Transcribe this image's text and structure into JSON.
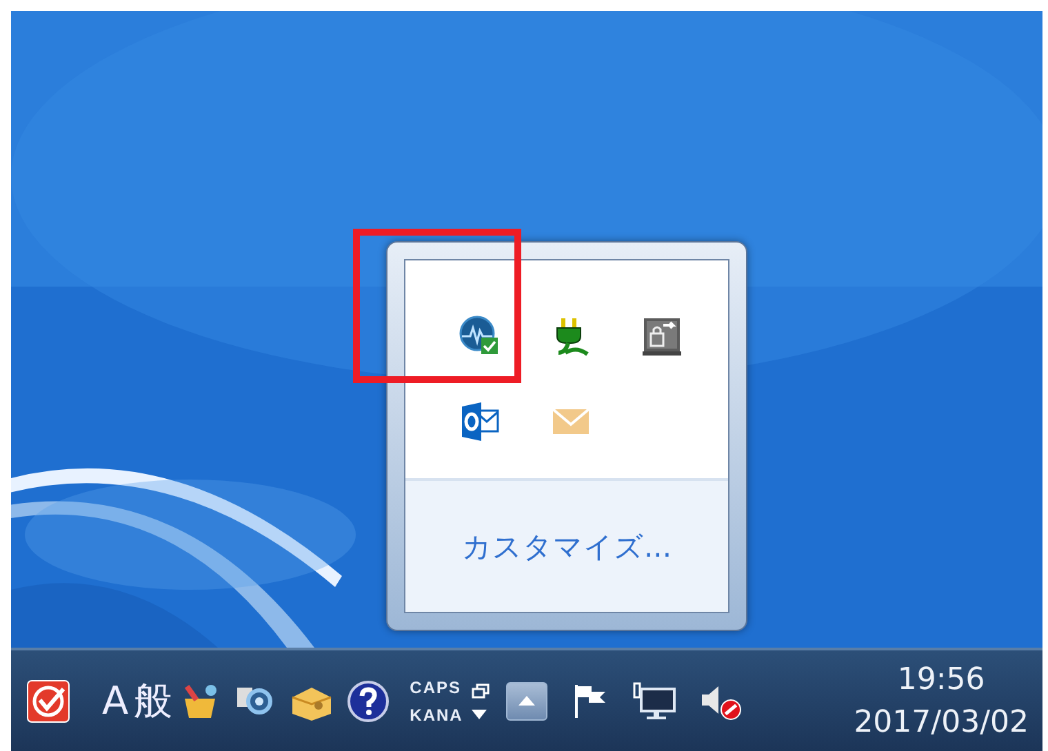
{
  "tray_popup": {
    "customize_link": "カスタマイズ..."
  },
  "taskbar": {
    "ime_mode": "A",
    "ime_dictionary": "般",
    "caps_indicator": "CAPS",
    "kana_indicator": "KANA",
    "clock": {
      "time": "19:56",
      "date": "2017/03/02"
    }
  }
}
